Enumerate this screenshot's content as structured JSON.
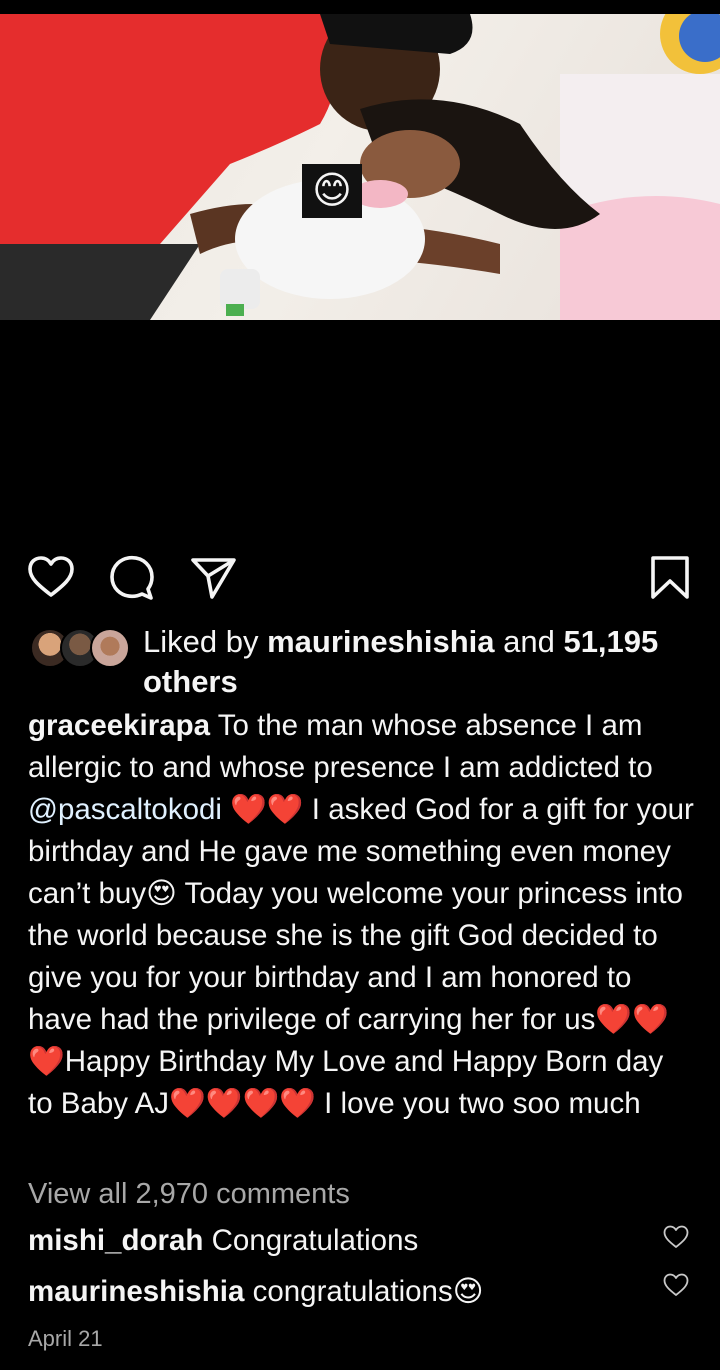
{
  "post": {
    "sticker_emoji": "😊"
  },
  "actions": {
    "like_icon": "heart-outline-icon",
    "comment_icon": "comment-bubble-icon",
    "share_icon": "paper-plane-icon",
    "save_icon": "bookmark-icon"
  },
  "likes": {
    "prefix": "Liked by ",
    "user": "maurineshishia",
    "middle": " and ",
    "count": "51,195",
    "suffix": " others"
  },
  "caption": {
    "author": "graceekirapa",
    "text_1": " To the man whose absence I am allergic to and whose presence I am addicted to ",
    "mention": "@pascaltokodi",
    "text_2": " ❤️❤️ I asked God for a gift for your birthday and He gave me something even money can’t buy😍 Today you welcome your princess into the world because she is the gift God decided to give you for your birthday and I am honored to have had the privilege of carrying her for us❤️❤️❤️Happy Birthday My Love and Happy Born day to Baby AJ❤️❤️❤️❤️ I love you two soo much"
  },
  "view_all_comments": "View all 2,970 comments",
  "comments": [
    {
      "user": "mishi_dorah",
      "text": " Congratulations"
    },
    {
      "user": "maurineshishia",
      "text": " congratulations😍"
    }
  ],
  "date": "April 21",
  "colors": {
    "background": "#000000",
    "text": "#f5f5f5",
    "muted": "#a8a8a8",
    "mention": "#e0f1ff"
  }
}
